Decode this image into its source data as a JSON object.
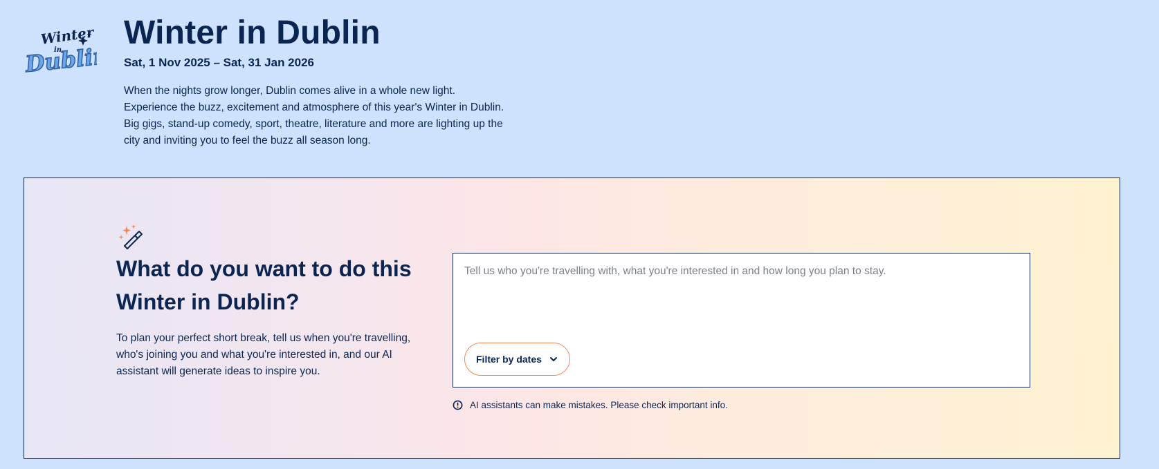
{
  "hero": {
    "logo": {
      "line1": "Winter",
      "line2": "in",
      "line3": "Dublin"
    },
    "title": "Winter in Dublin",
    "dates": "Sat, 1 Nov 2025 – Sat, 31 Jan 2026",
    "description": "When the nights grow longer, Dublin comes alive in a whole new light. Experience the buzz, excitement and atmosphere of this year's Winter in Dublin. Big gigs, stand-up comedy, sport, theatre, literature and more are lighting up the city and inviting you to feel the buzz all season long."
  },
  "planner": {
    "icon": "magic-wand-icon",
    "title": "What do you want to do this Winter in Dublin?",
    "description": "To plan your perfect short break, tell us when you're travelling, who's joining you and what you're interested in, and our AI assistant will generate ideas to inspire you.",
    "input": {
      "value": "",
      "placeholder": "Tell us who you're travelling with, what you're interested in and how long you plan to stay."
    },
    "filter_label": "Filter by dates",
    "filter_icon": "chevron-down-icon",
    "disclaimer_icon": "alert-circle-icon",
    "disclaimer": "AI assistants can make mistakes. Please check important info."
  },
  "colors": {
    "background": "#cfe2fd",
    "navy": "#0b2552",
    "accent_orange": "#f08a58",
    "logo_blue": "#4f8fd8"
  }
}
